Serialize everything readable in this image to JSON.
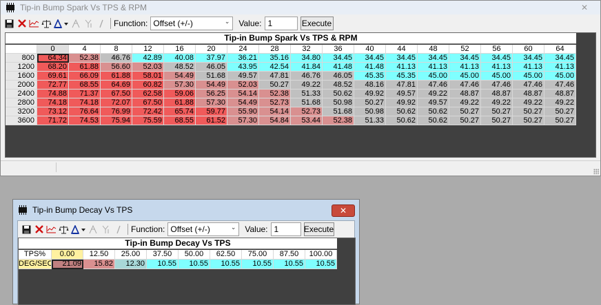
{
  "toolbar_icons": [
    "save-icon",
    "delete-icon",
    "graph-icon",
    "scale-icon",
    "calibrate-icon",
    "interpolate-icon",
    "smooth-icon",
    "edit-icon"
  ],
  "colors": {
    "red": "#f05a5a",
    "pink": "#d99090",
    "grey": "#c0c0c0",
    "cyan": "#7fffff",
    "yellow": "#fff1a0"
  },
  "window1": {
    "title": "Tip-in Bump Spark Vs TPS & RPM",
    "close_glyph": "✕",
    "toolbar": {
      "function_label": "Function:",
      "function_value": "Offset (+/-)",
      "value_label": "Value:",
      "value": "1",
      "execute_label": "Execute"
    },
    "table": {
      "title": "Tip-in Bump Spark Vs TPS & RPM",
      "columns": [
        "0",
        "4",
        "8",
        "12",
        "16",
        "20",
        "24",
        "28",
        "32",
        "36",
        "40",
        "44",
        "48",
        "52",
        "56",
        "60",
        "64"
      ],
      "rows": [
        {
          "rpm": "800",
          "values": [
            "64.34",
            "52.38",
            "46.76",
            "42.89",
            "40.08",
            "37.97",
            "36.21",
            "35.16",
            "34.80",
            "34.45",
            "34.45",
            "34.45",
            "34.45",
            "34.45",
            "34.45",
            "34.45",
            "34.45"
          ]
        },
        {
          "rpm": "1200",
          "values": [
            "68.20",
            "61.88",
            "56.60",
            "52.03",
            "48.52",
            "46.05",
            "43.95",
            "42.54",
            "41.84",
            "41.48",
            "41.48",
            "41.13",
            "41.13",
            "41.13",
            "41.13",
            "41.13",
            "41.13"
          ]
        },
        {
          "rpm": "1600",
          "values": [
            "69.61",
            "66.09",
            "61.88",
            "58.01",
            "54.49",
            "51.68",
            "49.57",
            "47.81",
            "46.76",
            "46.05",
            "45.35",
            "45.35",
            "45.00",
            "45.00",
            "45.00",
            "45.00",
            "45.00"
          ]
        },
        {
          "rpm": "2000",
          "values": [
            "72.77",
            "68.55",
            "64.69",
            "60.82",
            "57.30",
            "54.49",
            "52.03",
            "50.27",
            "49.22",
            "48.52",
            "48.16",
            "47.81",
            "47.46",
            "47.46",
            "47.46",
            "47.46",
            "47.46"
          ]
        },
        {
          "rpm": "2400",
          "values": [
            "74.88",
            "71.37",
            "67.50",
            "62.58",
            "59.06",
            "56.25",
            "54.14",
            "52.38",
            "51.33",
            "50.62",
            "49.92",
            "49.57",
            "49.22",
            "48.87",
            "48.87",
            "48.87",
            "48.87"
          ]
        },
        {
          "rpm": "2800",
          "values": [
            "74.18",
            "74.18",
            "72.07",
            "67.50",
            "61.88",
            "57.30",
            "54.49",
            "52.73",
            "51.68",
            "50.98",
            "50.27",
            "49.92",
            "49.57",
            "49.22",
            "49.22",
            "49.22",
            "49.22"
          ]
        },
        {
          "rpm": "3200",
          "values": [
            "73.12",
            "76.64",
            "76.99",
            "72.42",
            "65.74",
            "59.77",
            "55.90",
            "54.14",
            "52.73",
            "51.68",
            "50.98",
            "50.62",
            "50.62",
            "50.27",
            "50.27",
            "50.27",
            "50.27"
          ]
        },
        {
          "rpm": "3600",
          "values": [
            "71.72",
            "74.53",
            "75.94",
            "75.59",
            "68.55",
            "61.52",
            "57.30",
            "54.84",
            "53.44",
            "52.38",
            "51.33",
            "50.62",
            "50.62",
            "50.27",
            "50.27",
            "50.27",
            "50.27"
          ]
        }
      ]
    }
  },
  "window2": {
    "title": "Tip-in Bump Decay Vs TPS",
    "close_glyph": "✕",
    "toolbar": {
      "function_label": "Function:",
      "function_value": "Offset (+/-)",
      "value_label": "Value:",
      "value": "1",
      "execute_label": "Execute"
    },
    "table": {
      "title": "Tip-in Bump Decay Vs TPS",
      "row_header": "TPS%",
      "row_label": "DEG/SEC",
      "columns": [
        "0.00",
        "12.50",
        "25.00",
        "37.50",
        "50.00",
        "62.50",
        "75.00",
        "87.50",
        "100.00"
      ],
      "values": [
        "21.09",
        "15.82",
        "12.30",
        "10.55",
        "10.55",
        "10.55",
        "10.55",
        "10.55",
        "10.55"
      ]
    }
  }
}
